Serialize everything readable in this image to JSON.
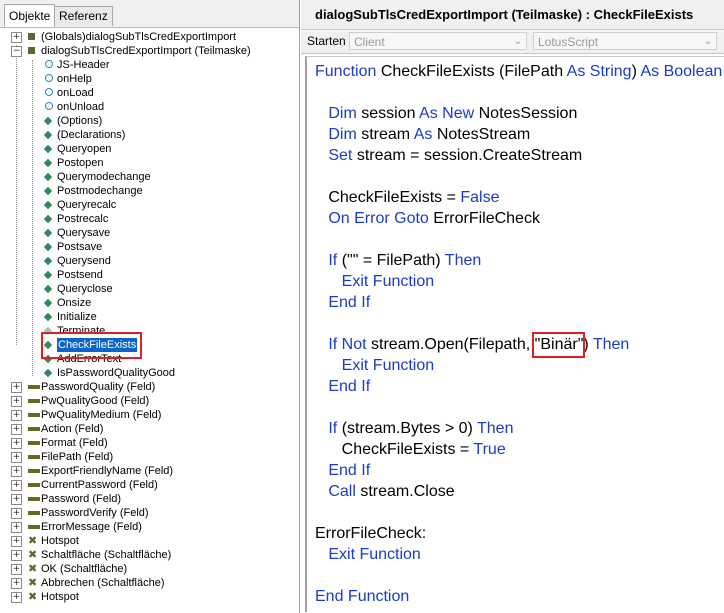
{
  "left_tabs": [
    "Objekte",
    "Referenz"
  ],
  "tree": [
    {
      "label": "(Globals)dialogSubTlsCredExportImport",
      "expander": "+"
    },
    {
      "label": "dialogSubTlsCredExportImport (Teilmaske)",
      "expander": "−"
    },
    {
      "label": "JS-Header"
    },
    {
      "label": "onHelp"
    },
    {
      "label": "onLoad"
    },
    {
      "label": "onUnload"
    },
    {
      "label": "(Options)"
    },
    {
      "label": "(Declarations)"
    },
    {
      "label": "Queryopen"
    },
    {
      "label": "Postopen"
    },
    {
      "label": "Querymodechange"
    },
    {
      "label": "Postmodechange"
    },
    {
      "label": "Queryrecalc"
    },
    {
      "label": "Postrecalc"
    },
    {
      "label": "Querysave"
    },
    {
      "label": "Postsave"
    },
    {
      "label": "Querysend"
    },
    {
      "label": "Postsend"
    },
    {
      "label": "Queryclose"
    },
    {
      "label": "Onsize"
    },
    {
      "label": "Initialize"
    },
    {
      "label": "Terminate"
    },
    {
      "label": "CheckFileExists"
    },
    {
      "label": "AddErrorText"
    },
    {
      "label": "IsPasswordQualityGood"
    },
    {
      "label": "PasswordQuality (Feld)",
      "expander": "+"
    },
    {
      "label": "PwQualityGood (Feld)",
      "expander": "+"
    },
    {
      "label": "PwQualityMedium (Feld)",
      "expander": "+"
    },
    {
      "label": "Action (Feld)",
      "expander": "+"
    },
    {
      "label": "Format (Feld)",
      "expander": "+"
    },
    {
      "label": "FilePath (Feld)",
      "expander": "+"
    },
    {
      "label": "ExportFriendlyName (Feld)",
      "expander": "+"
    },
    {
      "label": "CurrentPassword (Feld)",
      "expander": "+"
    },
    {
      "label": "Password (Feld)",
      "expander": "+"
    },
    {
      "label": "PasswordVerify (Feld)",
      "expander": "+"
    },
    {
      "label": "ErrorMessage (Feld)",
      "expander": "+"
    },
    {
      "label": "Hotspot",
      "expander": "+"
    },
    {
      "label": "Schaltfläche (Schaltfläche)",
      "expander": "+"
    },
    {
      "label": "OK (Schaltfläche)",
      "expander": "+"
    },
    {
      "label": "Abbrechen (Schaltfläche)",
      "expander": "+"
    },
    {
      "label": "Hotspot",
      "expander": "+"
    }
  ],
  "right": {
    "title": "dialogSubTlsCredExportImport (Teilmaske) : CheckFileExists",
    "run_label": "Starten",
    "run_select": "Client",
    "lang_select": "LotusScript"
  },
  "code": [
    [
      {
        "k": 1,
        "t": "Function "
      },
      {
        "k": 0,
        "t": "CheckFileExists (FilePath "
      },
      {
        "k": 1,
        "t": "As String"
      },
      {
        "k": 0,
        "t": ") "
      },
      {
        "k": 1,
        "t": "As Boolean"
      }
    ],
    [],
    [
      {
        "k": 0,
        "t": "   "
      },
      {
        "k": 1,
        "t": "Dim "
      },
      {
        "k": 0,
        "t": "session "
      },
      {
        "k": 1,
        "t": "As New "
      },
      {
        "k": 0,
        "t": "NotesSession"
      }
    ],
    [
      {
        "k": 0,
        "t": "   "
      },
      {
        "k": 1,
        "t": "Dim "
      },
      {
        "k": 0,
        "t": "stream "
      },
      {
        "k": 1,
        "t": "As "
      },
      {
        "k": 0,
        "t": "NotesStream"
      }
    ],
    [
      {
        "k": 0,
        "t": "   "
      },
      {
        "k": 1,
        "t": "Set "
      },
      {
        "k": 0,
        "t": "stream = session.CreateStream"
      }
    ],
    [],
    [
      {
        "k": 0,
        "t": "   CheckFileExists = "
      },
      {
        "k": 1,
        "t": "False"
      }
    ],
    [
      {
        "k": 0,
        "t": "   "
      },
      {
        "k": 1,
        "t": "On Error Goto "
      },
      {
        "k": 0,
        "t": "ErrorFileCheck"
      }
    ],
    [],
    [
      {
        "k": 0,
        "t": "   "
      },
      {
        "k": 1,
        "t": "If "
      },
      {
        "k": 0,
        "t": "(\"\" = FilePath) "
      },
      {
        "k": 1,
        "t": "Then"
      }
    ],
    [
      {
        "k": 0,
        "t": "      "
      },
      {
        "k": 1,
        "t": "Exit Function"
      }
    ],
    [
      {
        "k": 0,
        "t": "   "
      },
      {
        "k": 1,
        "t": "End If"
      }
    ],
    [],
    [
      {
        "k": 0,
        "t": "   "
      },
      {
        "k": 1,
        "t": "If Not "
      },
      {
        "k": 0,
        "t": "stream.Open(Filepath, \"Binär\") "
      },
      {
        "k": 1,
        "t": "Then"
      }
    ],
    [
      {
        "k": 0,
        "t": "      "
      },
      {
        "k": 1,
        "t": "Exit Function"
      }
    ],
    [
      {
        "k": 0,
        "t": "   "
      },
      {
        "k": 1,
        "t": "End If"
      }
    ],
    [],
    [
      {
        "k": 0,
        "t": "   "
      },
      {
        "k": 1,
        "t": "If "
      },
      {
        "k": 0,
        "t": "(stream.Bytes > 0) "
      },
      {
        "k": 1,
        "t": "Then"
      }
    ],
    [
      {
        "k": 0,
        "t": "      CheckFileExists = "
      },
      {
        "k": 1,
        "t": "True"
      }
    ],
    [
      {
        "k": 0,
        "t": "   "
      },
      {
        "k": 1,
        "t": "End If"
      }
    ],
    [
      {
        "k": 0,
        "t": "   "
      },
      {
        "k": 1,
        "t": "Call "
      },
      {
        "k": 0,
        "t": "stream.Close"
      }
    ],
    [],
    [
      {
        "k": 0,
        "t": "ErrorFileCheck:"
      }
    ],
    [
      {
        "k": 0,
        "t": "   "
      },
      {
        "k": 1,
        "t": "Exit Function"
      }
    ],
    [],
    [
      {
        "k": 1,
        "t": "End Function"
      }
    ]
  ]
}
